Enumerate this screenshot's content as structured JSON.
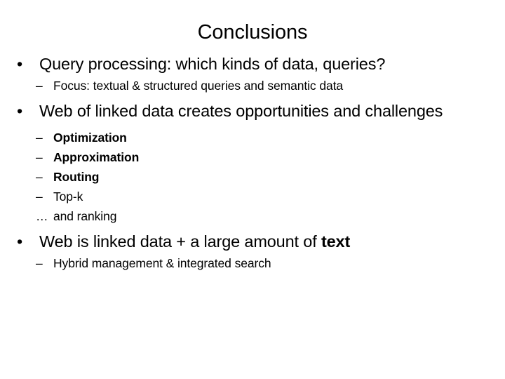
{
  "slide": {
    "title": "Conclusions",
    "background_color": "#ffffff",
    "text_color": "#000000",
    "bullet_marker": "•",
    "dash_marker": "–",
    "ellipsis_marker": "…",
    "content": [
      {
        "level": 1,
        "text": "Query processing: which kinds of data, queries?"
      },
      {
        "level": 2,
        "text": "Focus: textual & structured queries and semantic data",
        "bold": false
      },
      {
        "level": 1,
        "text": "Web of linked data creates opportunities and challenges"
      },
      {
        "level": 2,
        "text": "Optimization",
        "bold": true
      },
      {
        "level": 2,
        "text": "Approximation",
        "bold": true
      },
      {
        "level": 2,
        "text": "Routing",
        "bold": true
      },
      {
        "level": 2,
        "text": "Top-k",
        "bold": false
      },
      {
        "level": 2,
        "marker": "ellipsis",
        "text": "and ranking",
        "bold": false
      },
      {
        "level": 1,
        "text_parts": [
          {
            "text": "Web is linked data + a large amount of ",
            "bold": false
          },
          {
            "text": "text",
            "bold": true
          }
        ]
      },
      {
        "level": 2,
        "text": "Hybrid management & integrated search",
        "bold": false
      }
    ],
    "inline_text": {
      "b3_plain": "Web is linked data + a large amount of ",
      "b3_bold": "text"
    }
  }
}
